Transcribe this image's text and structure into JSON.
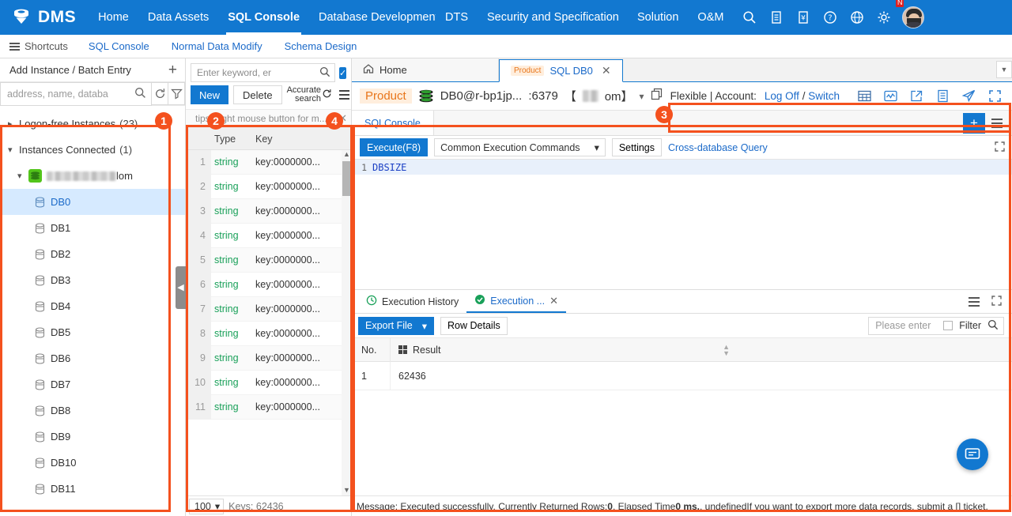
{
  "topnav": {
    "brand": "DMS",
    "brand_icon": "database-logo-icon",
    "items": [
      {
        "label": "Home"
      },
      {
        "label": "Data Assets"
      },
      {
        "label": "SQL Console"
      },
      {
        "label": "Database Development"
      },
      {
        "label": "DTS"
      },
      {
        "label": "Security and Specification"
      },
      {
        "label": "Solution"
      },
      {
        "label": "O&M"
      }
    ],
    "active_index": 2,
    "icons": [
      "search-icon",
      "document-icon",
      "ticket-icon",
      "help-icon",
      "globe-icon",
      "gear-icon"
    ],
    "badge": "N"
  },
  "shortcuts": {
    "label": "Shortcuts",
    "links": [
      "SQL Console",
      "Normal Data Modify",
      "Schema Design"
    ]
  },
  "left_panel": {
    "add_instance": "Add Instance / Batch Entry",
    "add_icon": "plus-icon",
    "search_placeholder": "address, name, databa",
    "refresh_icon": "refresh-icon",
    "filter_icon": "filter-icon",
    "groups": [
      {
        "label": "Logon-free Instances",
        "count": "(23)",
        "expanded": false
      },
      {
        "label": "Instances Connected",
        "count": "(1)",
        "expanded": true
      }
    ],
    "instance_suffix": "lom",
    "databases": [
      "DB0",
      "DB1",
      "DB2",
      "DB3",
      "DB4",
      "DB5",
      "DB6",
      "DB7",
      "DB8",
      "DB9",
      "DB10",
      "DB11"
    ],
    "selected_db": "DB0"
  },
  "key_panel": {
    "search_placeholder": "Enter keyword, er",
    "search_icon": "search-icon",
    "check_icon": "check-icon",
    "new_button": "New",
    "delete_button": "Delete",
    "accurate_search_line1": "Accurate",
    "accurate_search_line2": "search",
    "accurate_search_icon": "refresh-icon",
    "menu_icon": "list-menu-icon",
    "tips": "tips:Right mouse button for m...",
    "tips_close_icon": "close-icon",
    "columns": [
      "",
      "Type",
      "Key"
    ],
    "rows": [
      {
        "no": "1",
        "type": "string",
        "key": "key:0000000..."
      },
      {
        "no": "2",
        "type": "string",
        "key": "key:0000000..."
      },
      {
        "no": "3",
        "type": "string",
        "key": "key:0000000..."
      },
      {
        "no": "4",
        "type": "string",
        "key": "key:0000000..."
      },
      {
        "no": "5",
        "type": "string",
        "key": "key:0000000..."
      },
      {
        "no": "6",
        "type": "string",
        "key": "key:0000000..."
      },
      {
        "no": "7",
        "type": "string",
        "key": "key:0000000..."
      },
      {
        "no": "8",
        "type": "string",
        "key": "key:0000000..."
      },
      {
        "no": "9",
        "type": "string",
        "key": "key:0000000..."
      },
      {
        "no": "10",
        "type": "string",
        "key": "key:0000000..."
      },
      {
        "no": "11",
        "type": "string",
        "key": "key:0000000..."
      }
    ],
    "page_size": "100",
    "keys_total": "Keys: 62436",
    "collapse_icon": "chevron-left-icon"
  },
  "tabs": {
    "home_tab": "Home",
    "home_icon": "home-icon",
    "sql_tab_tag": "Product",
    "sql_tab_label": "SQL DB0",
    "close_icon": "close-icon",
    "more_icon": "chevron-down-icon"
  },
  "conn_bar": {
    "env_tag": "Product",
    "db_icon": "stack-database-icon",
    "conn_name": "DB0@r-bp1jp...",
    "port": ":6379",
    "bracket_open": "【",
    "bracket_close": "om】",
    "dropdown_icon": "chevron-down-icon",
    "copy_icon": "copy-icon",
    "account_prefix": "Flexible | Account:",
    "logoff": "Log Off",
    "separator": "/",
    "switch": "Switch",
    "icons": [
      "table-icon",
      "monitor-icon",
      "export-icon",
      "document-icon",
      "send-icon",
      "fullscreen-icon"
    ]
  },
  "console": {
    "tab_label": "SQLConsole",
    "add_icon": "plus-icon",
    "menu_icon": "list-menu-icon",
    "execute_button": "Execute(F8)",
    "common_commands": "Common Execution Commands",
    "common_commands_icon": "chevron-down-icon",
    "settings_button": "Settings",
    "cross_db_link": "Cross-database Query",
    "expand_icon": "fullscreen-icon",
    "editor_line_no": "1",
    "editor_code": "DBSIZE"
  },
  "history": {
    "history_tab": "Execution History",
    "history_icon": "clock-icon",
    "result_tab": "Execution ...",
    "result_status_icon": "success-check-icon",
    "result_close_icon": "close-icon",
    "menu_icon": "list-menu-icon",
    "expand_icon": "fullscreen-icon",
    "export_button": "Export File",
    "export_icon": "chevron-down-icon",
    "row_details_button": "Row Details",
    "filter_placeholder": "Please enter",
    "filter_label": "Filter",
    "filter_icon": "search-icon",
    "columns": [
      "No.",
      "Result"
    ],
    "result_col_icon": "grid-icon",
    "sort_icon": "sort-icon",
    "rows": [
      {
        "no": "1",
        "result": "62436"
      }
    ],
    "message": "Message: Executed successfully. Currently Returned Rows: 0, Elapsed Time 0 ms. ,  undefinedIf you want to export more data records, submit a [] ticket.",
    "message_parts": {
      "p1": "Message: Executed successfully. Currently Returned Rows: ",
      "rows": "0",
      "p2": ", Elapsed Time ",
      "time": "0 ms.",
      "p3": " ,  undefinedIf you want to export more data records, submit a [] ticket."
    },
    "fab_icon": "chat-icon"
  },
  "annotations": [
    {
      "num": "1"
    },
    {
      "num": "2"
    },
    {
      "num": "3"
    },
    {
      "num": "4"
    }
  ],
  "colors": {
    "brand_blue": "#1278d0",
    "link_blue": "#1b6ac9",
    "annotation_orange": "#f4511e",
    "success_green": "#19a059",
    "product_tag_bg": "#ffeedd",
    "product_tag_fg": "#e8751a"
  }
}
